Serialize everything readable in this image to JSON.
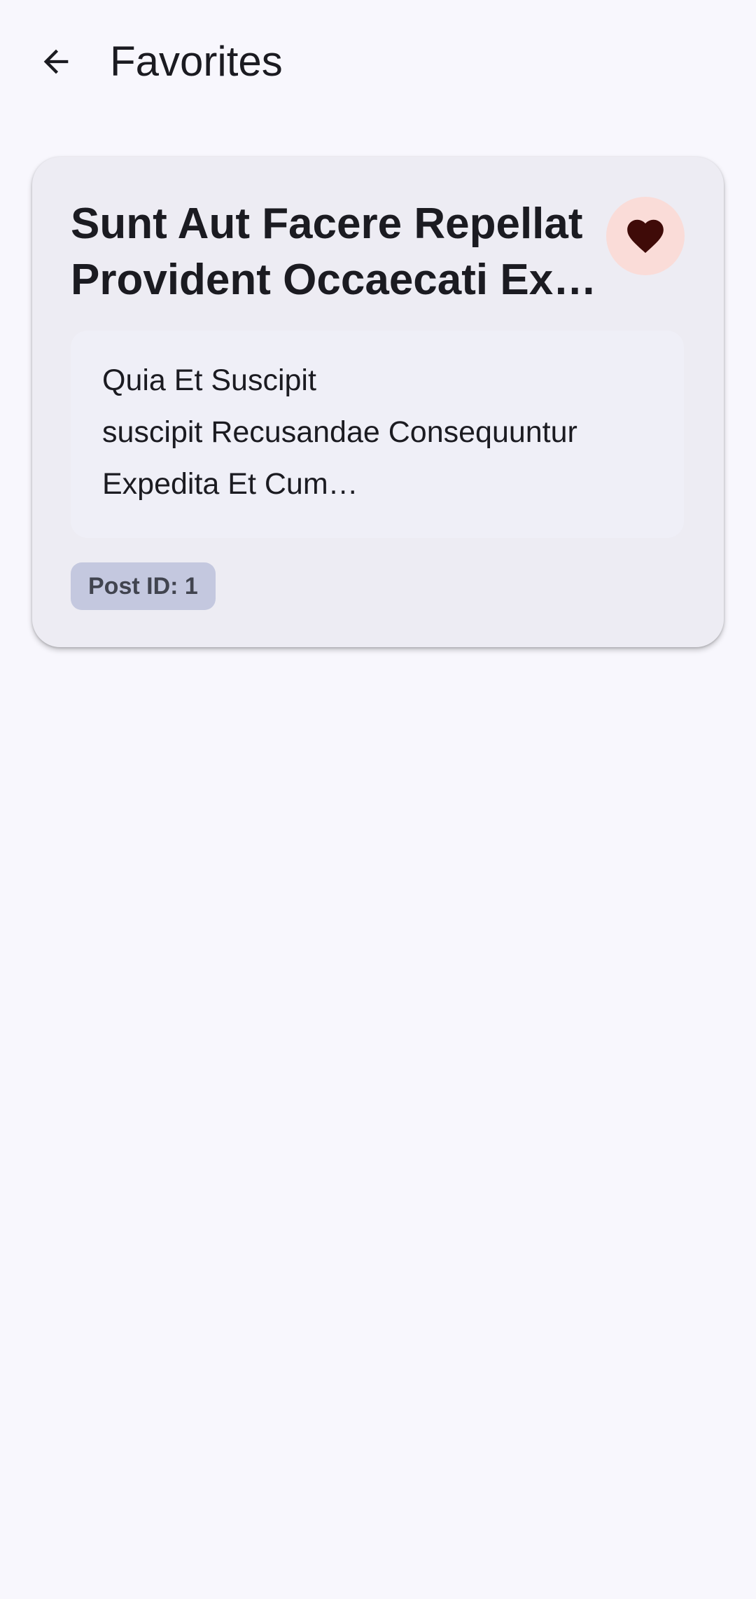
{
  "app_bar": {
    "back_icon": "arrow-back-icon",
    "title": "Favorites"
  },
  "favorites": [
    {
      "title_lines": [
        "Sunt Aut Facere Repellat",
        "Provident Occaecati Ex…"
      ],
      "favorite_icon": "heart-filled-icon",
      "favorited": true,
      "body_lines": [
        "Quia Et Suscipit",
        "suscipit Recusandae Consequuntur",
        "Expedita Et Cum…"
      ],
      "post_id_label": "Post ID: 1"
    }
  ],
  "colors": {
    "background": "#f8f7fd",
    "card": "#edecf3",
    "body_box": "#efeff7",
    "favorite_button_bg": "#fadcd8",
    "heart": "#3f0b08",
    "chip_bg": "#c4c8df",
    "chip_text": "#41444f",
    "text": "#1b1b21"
  }
}
